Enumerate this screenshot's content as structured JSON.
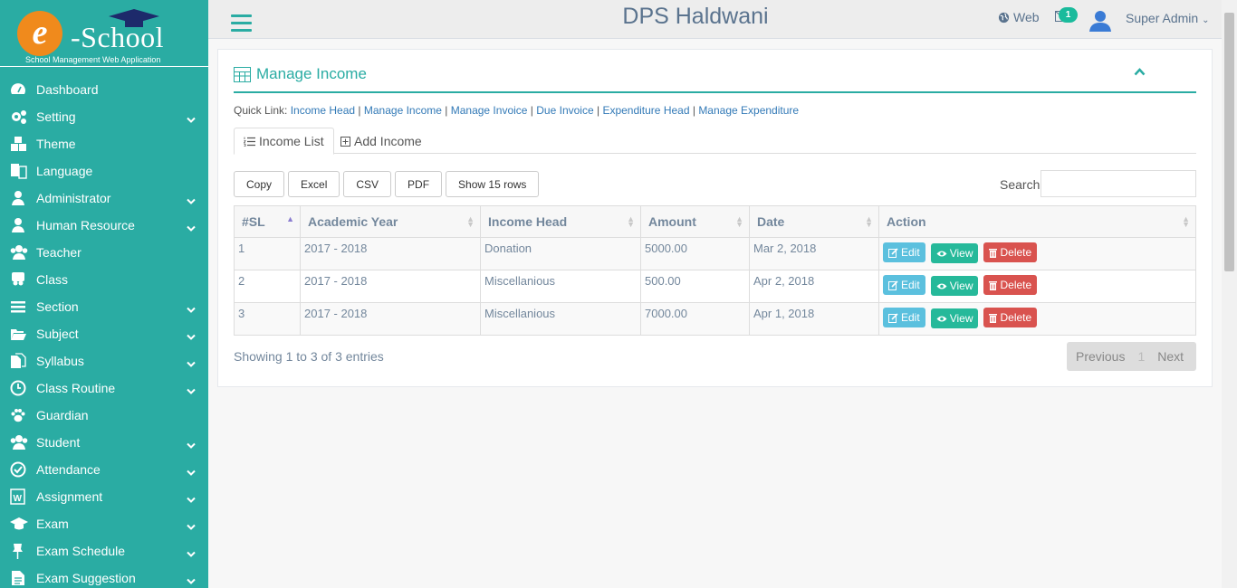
{
  "brand": {
    "initial": "e",
    "name": "-School",
    "tagline": "School Management Web Application"
  },
  "sidebar": {
    "items": [
      {
        "label": "Dashboard",
        "icon": "dashboard-icon",
        "expand": false
      },
      {
        "label": "Setting",
        "icon": "gears-icon",
        "expand": true
      },
      {
        "label": "Theme",
        "icon": "cubes-icon",
        "expand": false
      },
      {
        "label": "Language",
        "icon": "language-icon",
        "expand": false
      },
      {
        "label": "Administrator",
        "icon": "user-icon",
        "expand": true
      },
      {
        "label": "Human Resource",
        "icon": "user-icon",
        "expand": true
      },
      {
        "label": "Teacher",
        "icon": "users-icon",
        "expand": false
      },
      {
        "label": "Class",
        "icon": "slideshare-icon",
        "expand": false
      },
      {
        "label": "Section",
        "icon": "bars-icon",
        "expand": true
      },
      {
        "label": "Subject",
        "icon": "folder-open-icon",
        "expand": true
      },
      {
        "label": "Syllabus",
        "icon": "files-icon",
        "expand": true
      },
      {
        "label": "Class Routine",
        "icon": "clock-icon",
        "expand": true
      },
      {
        "label": "Guardian",
        "icon": "paw-icon",
        "expand": false
      },
      {
        "label": "Student",
        "icon": "users-icon",
        "expand": true
      },
      {
        "label": "Attendance",
        "icon": "check-circle-icon",
        "expand": true
      },
      {
        "label": "Assignment",
        "icon": "word-file-icon",
        "expand": true
      },
      {
        "label": "Exam",
        "icon": "graduation-cap-icon",
        "expand": true
      },
      {
        "label": "Exam Schedule",
        "icon": "thumb-tack-icon",
        "expand": true
      },
      {
        "label": "Exam Suggestion",
        "icon": "file-text-icon",
        "expand": true
      }
    ]
  },
  "header": {
    "title": "DPS Haldwani",
    "web_label": "Web",
    "mail_count": "1",
    "user_name": "Super Admin"
  },
  "panel": {
    "title": "Manage Income",
    "quick_label": "Quick Link:",
    "quick_links": [
      "Income Head",
      "Manage Income",
      "Manage Invoice",
      "Due Invoice",
      "Expenditure Head",
      "Manage Expenditure"
    ],
    "tabs": [
      "Income List",
      "Add Income"
    ],
    "buttons": [
      "Copy",
      "Excel",
      "CSV",
      "PDF",
      "Show 15 rows"
    ],
    "search_label": "Search:",
    "columns": [
      "#SL",
      "Academic Year",
      "Income Head",
      "Amount",
      "Date",
      "Action"
    ],
    "rows": [
      {
        "sl": "1",
        "year": "2017 - 2018",
        "head": "Donation",
        "amount": "5000.00",
        "date": "Mar 2, 2018"
      },
      {
        "sl": "2",
        "year": "2017 - 2018",
        "head": "Miscellanious",
        "amount": "500.00",
        "date": "Apr 2, 2018"
      },
      {
        "sl": "3",
        "year": "2017 - 2018",
        "head": "Miscellanious",
        "amount": "7000.00",
        "date": "Apr 1, 2018"
      }
    ],
    "actions": {
      "edit": "Edit",
      "view": "View",
      "delete": "Delete"
    },
    "info": "Showing 1 to 3 of 3 entries",
    "pager": {
      "prev": "Previous",
      "page": "1",
      "next": "Next"
    }
  },
  "colors": {
    "accent": "#2aaca3",
    "edit": "#5bc0de",
    "view": "#26b99a",
    "delete": "#d9534f"
  }
}
